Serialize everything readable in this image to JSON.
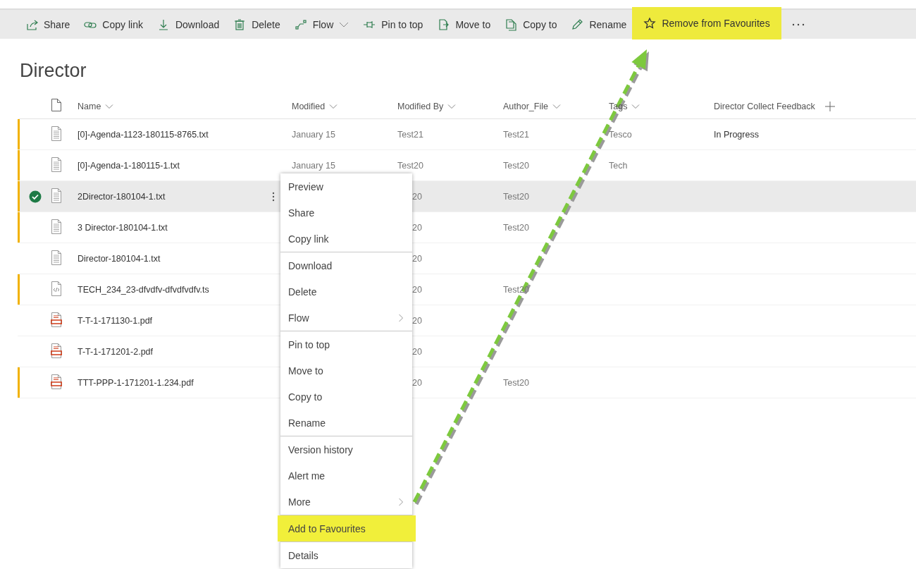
{
  "toolbar": {
    "items": [
      {
        "label": "Share",
        "dropdown": false,
        "highlighted": false
      },
      {
        "label": "Copy link",
        "dropdown": false,
        "highlighted": false
      },
      {
        "label": "Download",
        "dropdown": false,
        "highlighted": false
      },
      {
        "label": "Delete",
        "dropdown": false,
        "highlighted": false
      },
      {
        "label": "Flow",
        "dropdown": true,
        "highlighted": false
      },
      {
        "label": "Pin to top",
        "dropdown": false,
        "highlighted": false
      },
      {
        "label": "Move to",
        "dropdown": false,
        "highlighted": false
      },
      {
        "label": "Copy to",
        "dropdown": false,
        "highlighted": false
      },
      {
        "label": "Rename",
        "dropdown": false,
        "highlighted": false
      },
      {
        "label": "Remove from Favourites",
        "dropdown": false,
        "highlighted": true
      }
    ]
  },
  "list": {
    "title": "Director",
    "columns": [
      {
        "label": "Name",
        "sortable": true
      },
      {
        "label": "Modified",
        "sortable": true
      },
      {
        "label": "Modified By",
        "sortable": true
      },
      {
        "label": "Author_File",
        "sortable": true
      },
      {
        "label": "Tags",
        "sortable": true
      },
      {
        "label": "Director Collect Feedback",
        "sortable": false
      }
    ],
    "rows": [
      {
        "kind": "text",
        "name": "[0]-Agenda-1123-180115-8765.txt",
        "modified": "January 15",
        "modified_by": "Test21",
        "author_file": "Test21",
        "tags": "Tesco",
        "feedback": "In Progress",
        "flagged": true,
        "selected": false,
        "behind_menu": false
      },
      {
        "kind": "text",
        "name": "[0]-Agenda-1-180115-1.txt",
        "modified": "January 15",
        "modified_by": "Test20",
        "author_file": "Test20",
        "tags": "Tech",
        "flagged": true,
        "selected": false,
        "behind_menu": false
      },
      {
        "kind": "text",
        "name": "2Director-180104-1.txt",
        "modified_by": "20",
        "author_file": "Test20",
        "flagged": true,
        "selected": true,
        "behind_menu": true
      },
      {
        "kind": "text",
        "name": "3 Director-180104-1.txt",
        "modified_by": "20",
        "author_file": "Test20",
        "flagged": true,
        "selected": false,
        "behind_menu": true
      },
      {
        "kind": "text",
        "name": "Director-180104-1.txt",
        "modified_by": "20",
        "flagged": false,
        "selected": false,
        "behind_menu": true
      },
      {
        "kind": "code",
        "name": "TECH_234_23-dfvdfv-dfvdfvdfv.ts",
        "modified_by": "20",
        "author_file": "Test20",
        "flagged": true,
        "selected": false,
        "behind_menu": true
      },
      {
        "kind": "pdf",
        "name": "T-T-1-171130-1.pdf",
        "modified_by": "20",
        "flagged": false,
        "selected": false,
        "behind_menu": true
      },
      {
        "kind": "pdf",
        "name": "T-T-1-171201-2.pdf",
        "modified_by": "20",
        "flagged": false,
        "selected": false,
        "behind_menu": true
      },
      {
        "kind": "pdf",
        "name": "TTT-PPP-1-171201-1.234.pdf",
        "modified_by": "20",
        "author_file": "Test20",
        "flagged": true,
        "selected": false,
        "behind_menu": true
      }
    ]
  },
  "context_menu": {
    "groups": [
      [
        {
          "label": "Preview",
          "submenu": false,
          "highlighted": false
        },
        {
          "label": "Share",
          "submenu": false,
          "highlighted": false
        },
        {
          "label": "Copy link",
          "submenu": false,
          "highlighted": false
        }
      ],
      [
        {
          "label": "Download",
          "submenu": false,
          "highlighted": false
        },
        {
          "label": "Delete",
          "submenu": false,
          "highlighted": false
        },
        {
          "label": "Flow",
          "submenu": true,
          "highlighted": false
        }
      ],
      [
        {
          "label": "Pin to top",
          "submenu": false,
          "highlighted": false
        },
        {
          "label": "Move to",
          "submenu": false,
          "highlighted": false
        },
        {
          "label": "Copy to",
          "submenu": false,
          "highlighted": false
        },
        {
          "label": "Rename",
          "submenu": false,
          "highlighted": false
        }
      ],
      [
        {
          "label": "Version history",
          "submenu": false,
          "highlighted": false
        },
        {
          "label": "Alert me",
          "submenu": false,
          "highlighted": false
        },
        {
          "label": "More",
          "submenu": true,
          "highlighted": false
        }
      ],
      [
        {
          "label": "Add to Favourites",
          "submenu": false,
          "highlighted": true
        }
      ],
      [
        {
          "label": "Details",
          "submenu": false,
          "highlighted": false
        }
      ]
    ]
  }
}
